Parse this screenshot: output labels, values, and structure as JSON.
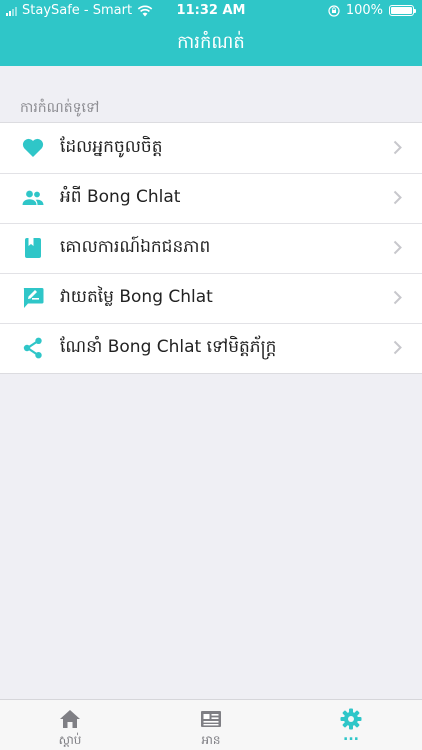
{
  "status_bar": {
    "carrier": "StaySafe - Smart",
    "time": "11:32 AM",
    "battery": "100%"
  },
  "header": {
    "title": "ការកំណត់"
  },
  "section": {
    "label": "ការកំណត់ទូទៅ"
  },
  "settings": {
    "items": [
      {
        "label": "ដែលអ្នកចូលចិត្ត",
        "icon": "heart-icon"
      },
      {
        "label": "អំពី Bong Chlat",
        "icon": "people-icon"
      },
      {
        "label": "គោលការណ៍ឯកជនភាព",
        "icon": "book-icon"
      },
      {
        "label": "វាយតម្លៃ Bong Chlat",
        "icon": "rate-icon"
      },
      {
        "label": "ណែនាំ Bong Chlat ទៅមិត្តភ័ក្រ្ត",
        "icon": "share-icon"
      }
    ]
  },
  "tabbar": {
    "tabs": [
      {
        "label": "ស្តាប់",
        "icon": "home-icon"
      },
      {
        "label": "អាន",
        "icon": "news-icon"
      },
      {
        "label": "...",
        "icon": "gear-icon"
      }
    ],
    "active_index": 2
  },
  "colors": {
    "accent": "#2fc6c8",
    "background": "#efeff4"
  }
}
